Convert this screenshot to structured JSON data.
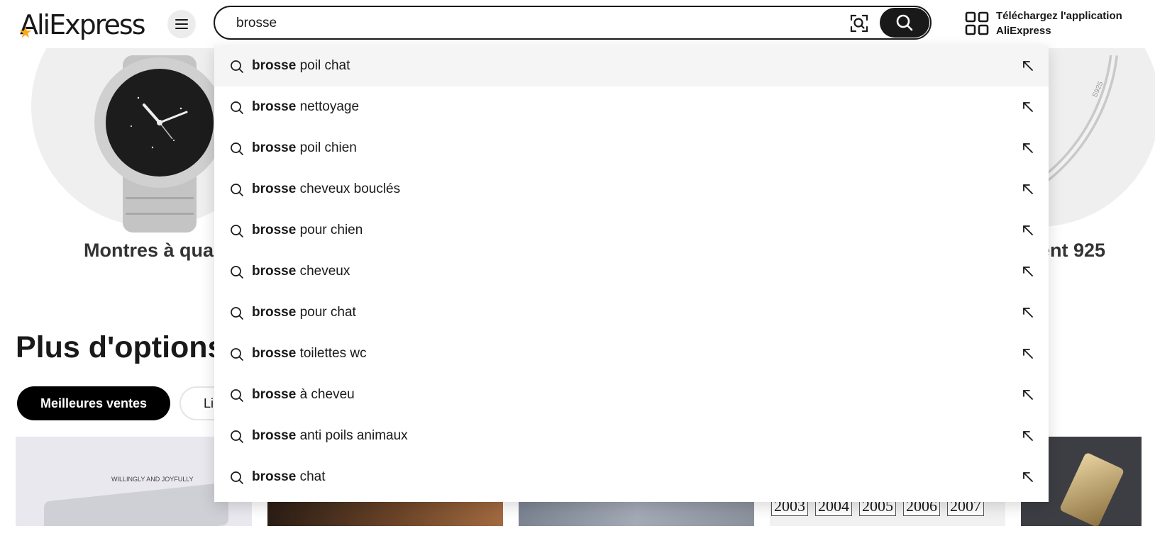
{
  "header": {
    "logo_text": "AliExpress",
    "search_value": "brosse",
    "app_download_line1": "Téléchargez l'application",
    "app_download_line2": "AliExpress"
  },
  "background": {
    "categories": [
      "Montres à quar",
      "ent 925"
    ],
    "section_title": "Plus d'options",
    "filter_pills": [
      "Meilleures ventes",
      "Li"
    ],
    "tile_caption": "WILLINGLY AND JOYFULLY",
    "ring_mark": "S925",
    "date_tabs": [
      "2003",
      "2004",
      "2005",
      "2006",
      "2007"
    ]
  },
  "suggestions": [
    {
      "bold": "brosse",
      "rest": " poil chat"
    },
    {
      "bold": "brosse",
      "rest": " nettoyage"
    },
    {
      "bold": "brosse",
      "rest": " poil chien"
    },
    {
      "bold": "brosse",
      "rest": " cheveux bouclés"
    },
    {
      "bold": "brosse",
      "rest": " pour chien"
    },
    {
      "bold": "brosse",
      "rest": " cheveux"
    },
    {
      "bold": "brosse",
      "rest": " pour chat"
    },
    {
      "bold": "brosse",
      "rest": " toilettes wc"
    },
    {
      "bold": "brosse",
      "rest": " à cheveu"
    },
    {
      "bold": "brosse",
      "rest": " anti poils animaux"
    },
    {
      "bold": "brosse",
      "rest": " chat"
    }
  ],
  "colors": {
    "accent_black": "#191919",
    "logo_star": "#f7a81b",
    "highlight_row": "#f5f5f5"
  },
  "icons": {
    "menu": "hamburger-icon",
    "camera": "image-search-icon",
    "search": "search-icon",
    "qr": "qr-code-icon",
    "suggestion_search": "search-icon",
    "suggestion_fill": "arrow-up-left-icon"
  }
}
